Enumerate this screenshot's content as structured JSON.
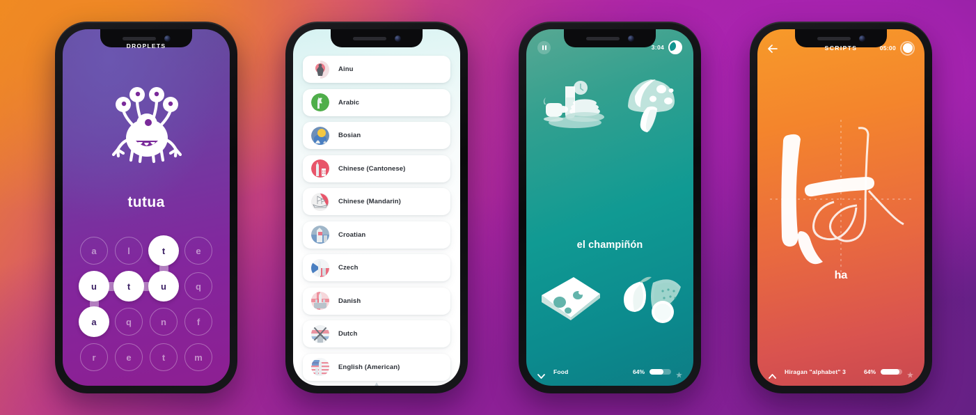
{
  "showcase": {
    "background_gradient": [
      "#ef8b21",
      "#d1497e",
      "#a6249f",
      "#7c1f96",
      "#5c2080"
    ]
  },
  "phone1": {
    "header_title": "DROPLETS",
    "mascot_icon": "multi-eyed-monster-mascot",
    "word": "tutua",
    "accent": "#8d1f92",
    "letter_grid": {
      "rows": 4,
      "cols": 4,
      "cells": [
        {
          "letter": "a",
          "selected": false
        },
        {
          "letter": "l",
          "selected": false
        },
        {
          "letter": "t",
          "selected": true
        },
        {
          "letter": "e",
          "selected": false
        },
        {
          "letter": "u",
          "selected": true
        },
        {
          "letter": "t",
          "selected": true
        },
        {
          "letter": "u",
          "selected": true
        },
        {
          "letter": "q",
          "selected": false
        },
        {
          "letter": "a",
          "selected": true
        },
        {
          "letter": "q",
          "selected": false
        },
        {
          "letter": "n",
          "selected": false
        },
        {
          "letter": "f",
          "selected": false
        },
        {
          "letter": "r",
          "selected": false
        },
        {
          "letter": "e",
          "selected": false
        },
        {
          "letter": "t",
          "selected": false
        },
        {
          "letter": "m",
          "selected": false
        }
      ],
      "path_order": [
        "t",
        "u",
        "t",
        "u",
        "a"
      ]
    }
  },
  "phone2": {
    "languages": [
      {
        "name": "Ainu",
        "icon": "ainu-landmark-flag-icon",
        "flag_colors": [
          "#ffffff",
          "#e8556a"
        ]
      },
      {
        "name": "Arabic",
        "icon": "arabic-mosque-flag-icon",
        "flag_colors": [
          "#4fae4a",
          "#2e8b3a"
        ]
      },
      {
        "name": "Bosian",
        "icon": "bosnian-landmark-flag-icon",
        "flag_colors": [
          "#f5c842",
          "#4a7fc1"
        ]
      },
      {
        "name": "Chinese (Cantonese)",
        "icon": "cantonese-landmark-flag-icon",
        "flag_colors": [
          "#e8556a",
          "#ffffff"
        ]
      },
      {
        "name": "Chinese (Mandarin)",
        "icon": "mandarin-junk-boat-flag-icon",
        "flag_colors": [
          "#e8556a",
          "#f0f0f0"
        ]
      },
      {
        "name": "Croatian",
        "icon": "croatian-landmark-flag-icon",
        "flag_colors": [
          "#e8556a",
          "#4a7fc1"
        ]
      },
      {
        "name": "Czech",
        "icon": "czech-landmark-flag-icon",
        "flag_colors": [
          "#4a7fc1",
          "#e8556a"
        ]
      },
      {
        "name": "Danish",
        "icon": "danish-landmark-flag-icon",
        "flag_colors": [
          "#e8556a",
          "#ffffff"
        ]
      },
      {
        "name": "Dutch",
        "icon": "dutch-windmill-flag-icon",
        "flag_colors": [
          "#e8556a",
          "#4a7fc1"
        ]
      },
      {
        "name": "English (American)",
        "icon": "american-monument-flag-icon",
        "flag_colors": [
          "#e8556a",
          "#4a7fc1"
        ]
      }
    ],
    "scroll_hint_icon": "scroll-up-caret-icon"
  },
  "phone3": {
    "pause_icon": "pause-icon",
    "timer": "3:04",
    "timer_icon": "moon-timer-icon",
    "word": "el champiñón",
    "images": [
      {
        "position": "top-left",
        "icon": "breakfast-pancakes-milk-coffee-icon"
      },
      {
        "position": "top-right",
        "icon": "mushroom-icon"
      },
      {
        "position": "bottom-left",
        "icon": "cheese-wedge-icon"
      },
      {
        "position": "bottom-right",
        "icon": "pear-watermelon-lime-fruit-icon"
      }
    ],
    "topic_label": "Food",
    "topic_collapse_icon": "chevron-down-icon",
    "progress_percent": "64%",
    "progress_value": 64,
    "star_icon": "star-icon",
    "accent": "#109a93"
  },
  "phone4": {
    "back_icon": "arrow-left-icon",
    "title": "SCRIPTS",
    "timer": "05:00",
    "timer_icon": "filled-dial-timer-icon",
    "character": "は",
    "character_romaji": "ha",
    "character_icon": "hiragana-ha-tracing-glyph",
    "topic_label": "Hiragan \"alphabet\" 3",
    "topic_collapse_icon": "chevron-up-icon",
    "progress_percent": "64%",
    "progress_value": 64,
    "star_icon": "star-icon",
    "accent": "#e96a3f"
  }
}
